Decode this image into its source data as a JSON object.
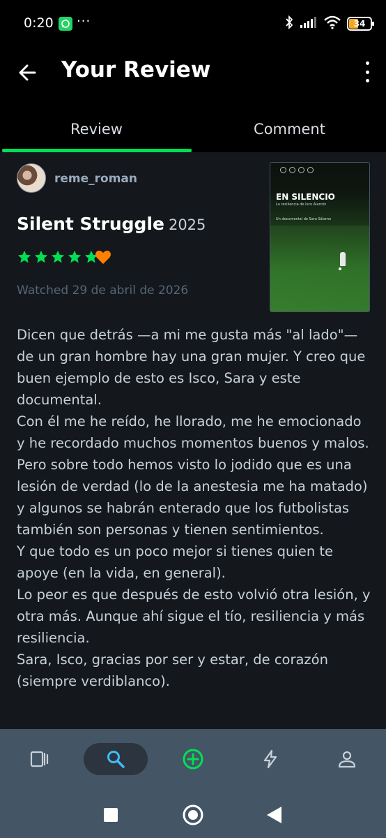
{
  "status_bar": {
    "time": "0:20",
    "dots": "···",
    "battery": "34"
  },
  "app_bar": {
    "title": "Your Review"
  },
  "tabs": [
    {
      "label": "Review",
      "active": true
    },
    {
      "label": "Comment",
      "active": false
    }
  ],
  "review": {
    "username": "reme_roman",
    "film_title": "Silent Struggle",
    "film_year": "2025",
    "rating_stars": 5,
    "liked": true,
    "watched": "Watched 29 de abril de 2026",
    "poster": {
      "title": "EN SILENCIO",
      "subtitle": "La resiliencia de Isco Alarcón",
      "credit": "Un documental de Sara Sálamo"
    },
    "text": "Dicen que detrás —a mi me gusta más \"al lado\"— de un gran hombre hay una gran mujer. Y creo que buen ejemplo de esto es Isco, Sara y este documental.\nCon él me he reído, he llorado, me he emocionado y he recordado muchos momentos buenos y malos. Pero sobre todo hemos visto lo jodido que es una lesión de verdad (lo de la anestesia me ha matado) y algunos se habrán enterado que los futbolistas también son personas y tienen sentimientos.\nY que todo es un poco mejor si tienes quien te apoye (en la vida, en general).\nLo peor es que después de esto volvió otra lesión, y otra más. Aunque ahí sigue el tío, resiliencia y más resiliencia.\nSara, Isco, gracias por ser y estar, de corazón (siempre verdiblanco)."
  },
  "bottom_nav": [
    {
      "icon": "films-icon",
      "active": false
    },
    {
      "icon": "search-icon",
      "active": true
    },
    {
      "icon": "add-icon",
      "active": false
    },
    {
      "icon": "activity-icon",
      "active": false
    },
    {
      "icon": "profile-icon",
      "active": false
    }
  ],
  "colors": {
    "accent_green": "#00e054",
    "heart_orange": "#ff8000",
    "background": "#14181c",
    "nav_background": "#445566"
  }
}
